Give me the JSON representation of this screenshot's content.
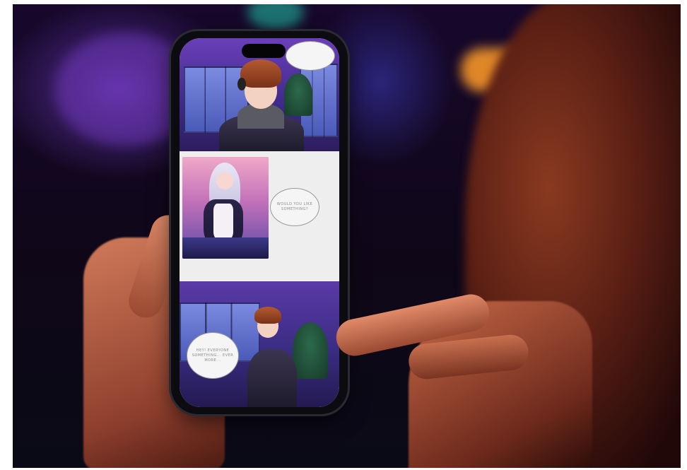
{
  "scene": {
    "description_alt": "",
    "palette": {
      "background_dark": "#0f0718",
      "purple_glow": "#6e3cbe",
      "orange_glow": "#e08a30",
      "skin": "#c8704f",
      "phone_frame": "#0c0c10"
    }
  },
  "comic": {
    "panel_2_bubble": "WOULD YOU LIKE SOMETHING?",
    "panel_3_bubble": "HEY! EVERYONE SOMETHING... EVER MORE..."
  }
}
